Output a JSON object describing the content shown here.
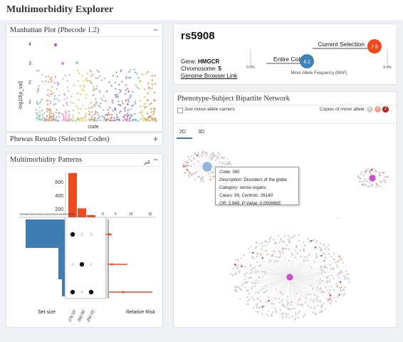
{
  "app": {
    "title": "Multimorbidity Explorer"
  },
  "manhattan": {
    "title": "Manhattan Plot (Phecode 1.2)",
    "ctrl": "−",
    "ylabel": "-log10(p_val)",
    "xlabel": "code",
    "yticks": [
      "4",
      "3",
      "2",
      "1"
    ]
  },
  "phewas": {
    "title": "Phewas Results (Selected Codes)",
    "ctrl": "+"
  },
  "upset": {
    "title": "Multimorbidity Patterns",
    "wrench_icon": "wrench-icon",
    "ctrl": "−",
    "bar_ticks": [
      "600",
      "400",
      "200"
    ],
    "set_axis_label": "70000600005000040000300002000010000",
    "rr_ticks": [
      "0",
      "5",
      "10",
      "15"
    ],
    "set_size_label": "Set size",
    "relative_risk_label": "Relative Risk",
    "codes": [
      "279.10⁻",
      "360.00⁻",
      "250.10⁻"
    ]
  },
  "snp": {
    "id": "rs5908",
    "gene_label": "Gene:",
    "gene": "HMGCR",
    "chrom_label": "Chromosome:",
    "chrom": "5",
    "browser_link": "Genome Browser Link",
    "current_label": "Current Selection",
    "current_value": "7.6",
    "cohort_label": "Entire Cohort",
    "cohort_value": "4.1",
    "axis_min": "0.0%",
    "axis_max": "8.4%",
    "axis_label": "Minor Allele Frequency (MAF)",
    "current_color": "#ee4a1f",
    "cohort_color": "#3e82b8"
  },
  "network": {
    "title": "Phenotype-Subject Bipartite Network",
    "checkbox_label": "Just minor-allele carriers",
    "copies_label": "Copies of minor allele:",
    "copies": [
      "0",
      "1",
      "2"
    ],
    "copy_colors": [
      "#cfcfcf",
      "#f2a285",
      "#b41f1f"
    ],
    "tabs": [
      "2D",
      "3D"
    ],
    "tooltip": {
      "code_label": "Code:",
      "code": "360",
      "desc_label": "Description:",
      "desc": "Disorders of the globe",
      "cat_label": "Category:",
      "cat": "sense organs",
      "cases_label": "Cases:",
      "cases": "99",
      "controls_label": "Controls:",
      "controls": "26140",
      "or_label": "OR:",
      "or": "2.848",
      "p_label": "P-Value:",
      "p": "0.0008665"
    }
  },
  "chart_data": {
    "type": "bar",
    "title": "Multimorbidity Patterns",
    "categories": [
      "279.10⁻",
      "360.00⁻",
      "250.10⁻"
    ],
    "series": [
      {
        "name": "intersection size",
        "values": [
          690,
          140,
          35
        ]
      }
    ],
    "ylim": [
      0,
      700
    ]
  }
}
